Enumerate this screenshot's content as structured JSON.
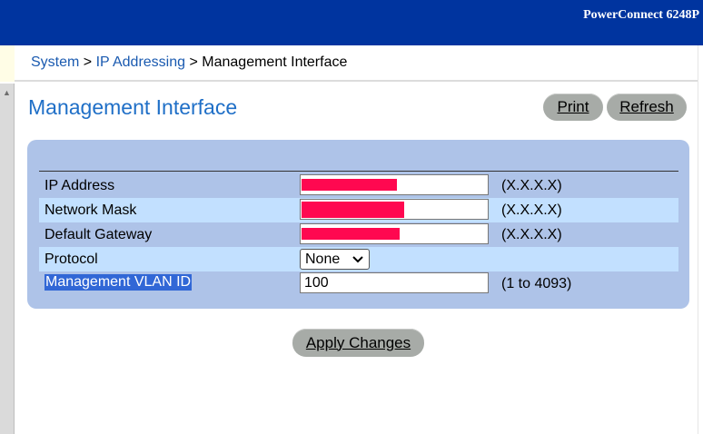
{
  "header": {
    "product_name": "PowerConnect 6248P"
  },
  "breadcrumb": {
    "items": [
      "System",
      "IP Addressing",
      "Management Interface"
    ],
    "separator": ">"
  },
  "page": {
    "title": "Management Interface"
  },
  "toolbar": {
    "print_label": "Print",
    "refresh_label": "Refresh"
  },
  "form": {
    "rows": [
      {
        "label": "IP Address",
        "value": "",
        "hint": "(X.X.X.X)",
        "redacted": true
      },
      {
        "label": "Network Mask",
        "value": "",
        "hint": "(X.X.X.X)",
        "redacted": true
      },
      {
        "label": "Default Gateway",
        "value": "",
        "hint": "(X.X.X.X)",
        "redacted": true
      },
      {
        "label": "Protocol",
        "selected": "None",
        "hint": ""
      },
      {
        "label": "Management VLAN ID",
        "value": "100",
        "hint": "(1 to 4093)"
      }
    ]
  },
  "apply_label": "Apply Changes",
  "colors": {
    "banner": "#00349f",
    "title": "#1f6fc7",
    "link": "#1a5ab0",
    "panel": "#aec3e8",
    "row_highlight": "#c2e0ff",
    "redaction": "#ff0850",
    "button": "#a7aba7",
    "selection": "#3167d6"
  },
  "icons": {
    "scroll_up": "triangle-up-icon",
    "select_arrow": "chevron-down-icon"
  }
}
